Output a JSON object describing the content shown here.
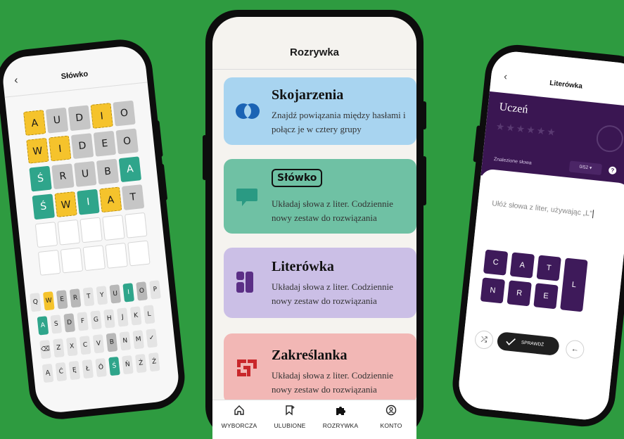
{
  "colors": {
    "background": "#2e9b40",
    "accent_purple": "#3a1652",
    "teal": "#2fa58b",
    "yellow": "#f5c32c"
  },
  "left_phone": {
    "title": "Słówko",
    "grid": [
      [
        {
          "l": "A",
          "s": "yellow"
        },
        {
          "l": "U",
          "s": "gray"
        },
        {
          "l": "D",
          "s": "gray"
        },
        {
          "l": "I",
          "s": "yellow"
        },
        {
          "l": "O",
          "s": "gray"
        }
      ],
      [
        {
          "l": "W",
          "s": "yellow"
        },
        {
          "l": "I",
          "s": "yellow"
        },
        {
          "l": "D",
          "s": "gray"
        },
        {
          "l": "E",
          "s": "gray"
        },
        {
          "l": "O",
          "s": "gray"
        }
      ],
      [
        {
          "l": "Ś",
          "s": "teal"
        },
        {
          "l": "R",
          "s": "gray"
        },
        {
          "l": "U",
          "s": "gray"
        },
        {
          "l": "B",
          "s": "gray"
        },
        {
          "l": "A",
          "s": "teal"
        }
      ],
      [
        {
          "l": "Ś",
          "s": "teal"
        },
        {
          "l": "W",
          "s": "yellow"
        },
        {
          "l": "I",
          "s": "teal"
        },
        {
          "l": "A",
          "s": "yellow"
        },
        {
          "l": "T",
          "s": "gray"
        }
      ],
      [
        {
          "l": "",
          "s": "empty"
        },
        {
          "l": "",
          "s": "empty"
        },
        {
          "l": "",
          "s": "empty"
        },
        {
          "l": "",
          "s": "empty"
        },
        {
          "l": "",
          "s": "empty"
        }
      ],
      [
        {
          "l": "",
          "s": "empty"
        },
        {
          "l": "",
          "s": "empty"
        },
        {
          "l": "",
          "s": "empty"
        },
        {
          "l": "",
          "s": "empty"
        },
        {
          "l": "",
          "s": "empty"
        }
      ]
    ],
    "keyboard": [
      [
        {
          "k": "Q"
        },
        {
          "k": "W",
          "s": "yellow"
        },
        {
          "k": "E",
          "s": "gray"
        },
        {
          "k": "R",
          "s": "gray"
        },
        {
          "k": "T"
        },
        {
          "k": "Y"
        },
        {
          "k": "U",
          "s": "gray"
        },
        {
          "k": "I",
          "s": "teal"
        },
        {
          "k": "O",
          "s": "gray"
        },
        {
          "k": "P"
        }
      ],
      [
        {
          "k": "A",
          "s": "teal"
        },
        {
          "k": "S"
        },
        {
          "k": "D",
          "s": "gray"
        },
        {
          "k": "F"
        },
        {
          "k": "G"
        },
        {
          "k": "H"
        },
        {
          "k": "J"
        },
        {
          "k": "K"
        },
        {
          "k": "L"
        }
      ],
      [
        {
          "k": "⌫"
        },
        {
          "k": "Z"
        },
        {
          "k": "X"
        },
        {
          "k": "C"
        },
        {
          "k": "V"
        },
        {
          "k": "B",
          "s": "gray"
        },
        {
          "k": "N"
        },
        {
          "k": "M"
        },
        {
          "k": "✓"
        }
      ],
      [
        {
          "k": "Ą"
        },
        {
          "k": "Ć"
        },
        {
          "k": "Ę"
        },
        {
          "k": "Ł"
        },
        {
          "k": "Ó"
        },
        {
          "k": "Ś",
          "s": "teal"
        },
        {
          "k": "Ń"
        },
        {
          "k": "Ż"
        },
        {
          "k": "Ź"
        }
      ]
    ]
  },
  "center_phone": {
    "title": "Rozrywka",
    "cards": [
      {
        "title": "Skojarzenia",
        "desc": "Znajdź powiązania między hasłami i połącz je w cztery grupy",
        "color": "#a8d4f0"
      },
      {
        "logo": "Słówko",
        "desc": "Układaj słowa z liter. Codziennie nowy zestaw do rozwiązania",
        "color": "#6fc1a4"
      },
      {
        "title": "Literówka",
        "desc": "Układaj słowa z liter. Codziennie nowy zestaw do rozwiązania",
        "color": "#cbbfe6"
      },
      {
        "title": "Zakreślanka",
        "desc": "Układaj słowa z liter. Codziennie nowy zestaw do rozwiązania",
        "color": "#f2b7b5"
      }
    ],
    "nav": [
      {
        "label": "WYBORCZA",
        "icon": "home-icon"
      },
      {
        "label": "ULUBIONE",
        "icon": "bookmark-icon"
      },
      {
        "label": "ROZRYWKA",
        "icon": "puzzle-icon"
      },
      {
        "label": "KONTO",
        "icon": "account-icon"
      }
    ]
  },
  "right_phone": {
    "title": "Literówka",
    "rank": "Uczeń",
    "found_label": "Znalezione słowa",
    "found_count": "0/52",
    "placeholder": "Ułóż słowa z liter, używając „L\"",
    "letters": [
      "C",
      "A",
      "T",
      "N",
      "R",
      "E"
    ],
    "center_letter": "L",
    "check_label": "SPRAWDŹ"
  }
}
